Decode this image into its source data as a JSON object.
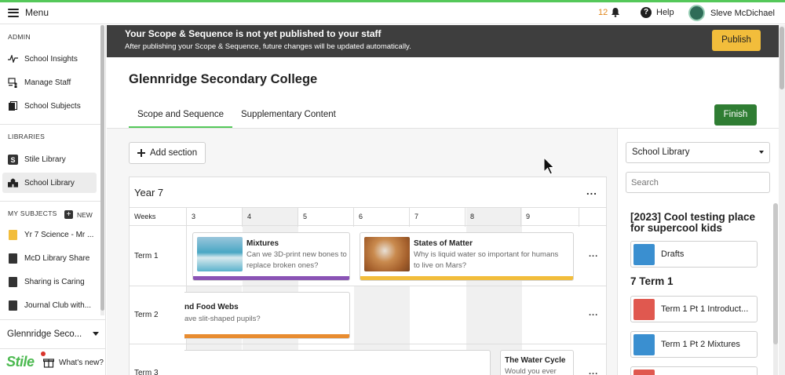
{
  "topbar": {
    "menu_label": "Menu",
    "notifications_count": "12",
    "help_label": "Help",
    "user_name": "Sleve McDichael"
  },
  "sidebar": {
    "admin_heading": "ADMIN",
    "admin_items": [
      {
        "label": "School Insights",
        "icon": "pulse-icon"
      },
      {
        "label": "Manage Staff",
        "icon": "staff-icon"
      },
      {
        "label": "School Subjects",
        "icon": "books-icon"
      }
    ],
    "libraries_heading": "LIBRARIES",
    "library_items": [
      {
        "label": "Stile Library",
        "icon": "stile-s-icon"
      },
      {
        "label": "School Library",
        "icon": "school-icon",
        "active": true
      }
    ],
    "subjects_heading": "MY SUBJECTS",
    "new_label": "NEW",
    "subject_items": [
      {
        "label": "Yr 7 Science - Mr ...",
        "color": "#f2bd3b"
      },
      {
        "label": "McD Library Share",
        "color": "#333333"
      },
      {
        "label": "Sharing is Caring",
        "color": "#333333"
      },
      {
        "label": "Journal Club with...",
        "color": "#333333"
      }
    ],
    "school_name": "Glennridge Seco...",
    "brand": "Stile",
    "whats_new": "What's new?"
  },
  "banner": {
    "title": "Your Scope & Sequence is not yet published to your staff",
    "subtitle": "After publishing your Scope & Sequence, future changes will be updated automatically.",
    "publish_label": "Publish"
  },
  "main": {
    "title": "Glennridge Secondary College",
    "tabs": [
      {
        "label": "Scope and Sequence",
        "active": true
      },
      {
        "label": "Supplementary Content",
        "active": false
      }
    ],
    "finish_label": "Finish",
    "add_section_label": "Add section"
  },
  "year": {
    "title": "Year 7",
    "more": "...",
    "weeks_label": "Weeks",
    "weeks": [
      "3",
      "4",
      "5",
      "6",
      "7",
      "8",
      "9"
    ],
    "terms": [
      {
        "label": "Term 1",
        "more": "..."
      },
      {
        "label": "Term 2",
        "more": "..."
      },
      {
        "label": "Term 3",
        "more": "..."
      }
    ],
    "lessons": {
      "mixtures": {
        "name": "Mixtures",
        "question": "Can we 3D-print new bones to replace broken ones?",
        "bar_color": "#8a53b5"
      },
      "states": {
        "name": "States of Matter",
        "question": "Why is liquid water so important for humans to live on Mars?",
        "bar_color": "#f2bd3b"
      },
      "food_webs": {
        "name": "nd Food Webs",
        "question": "ave slit-shaped pupils?",
        "bar_color": "#e88c30"
      },
      "water_cycle": {
        "name": "The Water Cycle",
        "question": "Would you ever"
      }
    }
  },
  "library_panel": {
    "select_value": "School Library",
    "search_placeholder": "Search",
    "group_heading": "[2023] Cool testing place for supercool kids",
    "drafts_label": "Drafts",
    "term_heading": "7 Term 1",
    "items": [
      {
        "label": "Term 1 Pt 1 Introduct...",
        "color": "#e0584f"
      },
      {
        "label": "Term 1 Pt 2 Mixtures",
        "color": "#3a8fd0"
      }
    ]
  },
  "colors": {
    "accent_green": "#55c85a",
    "publish_yellow": "#f2bd3b",
    "finish_green": "#2f7d33",
    "banner_bg": "#3e3e3e"
  }
}
